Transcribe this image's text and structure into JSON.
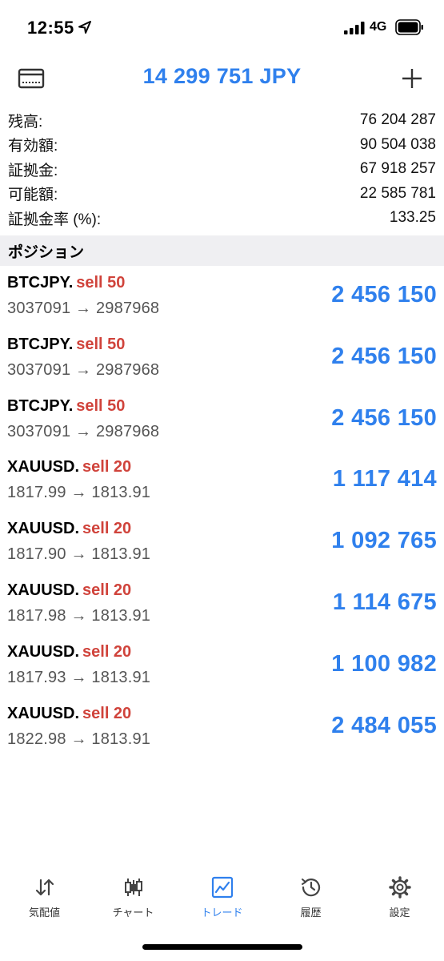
{
  "status_bar": {
    "time": "12:55",
    "network": "4G",
    "icons": [
      "location-arrow-icon",
      "signal-icon",
      "battery-icon"
    ]
  },
  "header": {
    "balance_title": "14 299 751 JPY",
    "left_icon": "card-icon",
    "right_icon": "plus-icon"
  },
  "summary": [
    {
      "label": "残高:",
      "value": "76 204 287"
    },
    {
      "label": "有効額:",
      "value": "90 504 038"
    },
    {
      "label": "証拠金:",
      "value": "67 918 257"
    },
    {
      "label": "可能額:",
      "value": "22 585 781"
    },
    {
      "label": "証拠金率 (%):",
      "value": "133.25"
    }
  ],
  "section_title": "ポジション",
  "positions": [
    {
      "symbol": "BTCJPY.",
      "side": "sell 50",
      "prices": "3037091 → 2987968",
      "profit": "2 456 150"
    },
    {
      "symbol": "BTCJPY.",
      "side": "sell 50",
      "prices": "3037091 → 2987968",
      "profit": "2 456 150"
    },
    {
      "symbol": "BTCJPY.",
      "side": "sell 50",
      "prices": "3037091 → 2987968",
      "profit": "2 456 150"
    },
    {
      "symbol": "XAUUSD.",
      "side": "sell 20",
      "prices": "1817.99 → 1813.91",
      "profit": "1 117 414"
    },
    {
      "symbol": "XAUUSD.",
      "side": "sell 20",
      "prices": "1817.90 → 1813.91",
      "profit": "1 092 765"
    },
    {
      "symbol": "XAUUSD.",
      "side": "sell 20",
      "prices": "1817.98 → 1813.91",
      "profit": "1 114 675"
    },
    {
      "symbol": "XAUUSD.",
      "side": "sell 20",
      "prices": "1817.93 → 1813.91",
      "profit": "1 100 982"
    },
    {
      "symbol": "XAUUSD.",
      "side": "sell 20",
      "prices": "1822.98 → 1813.91",
      "profit": "2 484 055"
    }
  ],
  "tabs": [
    {
      "label": "気配値",
      "icon": "quotes-arrows-icon",
      "active": false
    },
    {
      "label": "チャート",
      "icon": "candlestick-chart-icon",
      "active": false
    },
    {
      "label": "トレード",
      "icon": "trade-chart-icon",
      "active": true
    },
    {
      "label": "履歴",
      "icon": "history-clock-icon",
      "active": false
    },
    {
      "label": "設定",
      "icon": "gear-icon",
      "active": false
    }
  ],
  "colors": {
    "accent_blue": "#2f80ed",
    "sell_red": "#d0433b",
    "section_bg": "#efeff2"
  }
}
